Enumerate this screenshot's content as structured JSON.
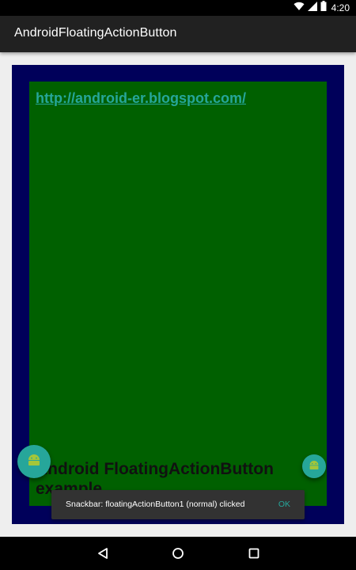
{
  "status_bar": {
    "time": "4:20",
    "icons": [
      "wifi-icon",
      "signal-icon",
      "battery-icon"
    ]
  },
  "app_bar": {
    "title": "AndroidFloatingActionButton"
  },
  "content": {
    "link_text": "http://android-er.blogspot.com/",
    "example_text": "Android FloatingActionButton example"
  },
  "fabs": {
    "normal_icon": "android-icon",
    "mini_icon": "android-icon"
  },
  "snackbar": {
    "message": "Snackbar: floatingActionButton1 (normal) clicked",
    "action": "OK"
  },
  "nav_bar": {
    "icons": [
      "back-icon",
      "home-icon",
      "recents-icon"
    ]
  },
  "colors": {
    "status_bar": "#000000",
    "app_bar": "#212121",
    "background": "#eeeeee",
    "outer_frame": "#00005a",
    "inner_frame": "#006000",
    "accent": "#26a69a",
    "snackbar": "#323232"
  }
}
